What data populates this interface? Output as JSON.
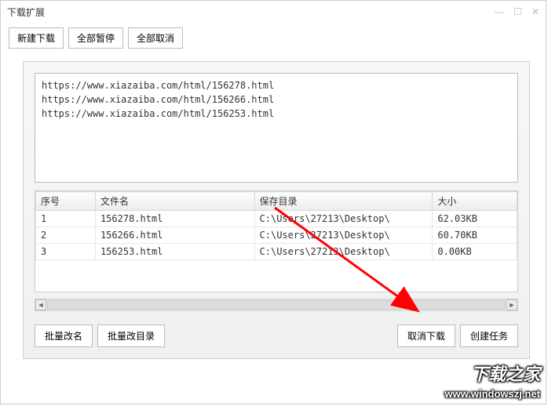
{
  "window": {
    "title": "下载扩展"
  },
  "toolbar": {
    "new_download": "新建下载",
    "pause_all": "全部暂停",
    "cancel_all": "全部取消"
  },
  "urls_text": "https://www.xiazaiba.com/html/156278.html\nhttps://www.xiazaiba.com/html/156266.html\nhttps://www.xiazaiba.com/html/156253.html",
  "table": {
    "headers": {
      "index": "序号",
      "filename": "文件名",
      "dir": "保存目录",
      "size": "大小"
    },
    "rows": [
      {
        "index": "1",
        "filename": "156278.html",
        "dir": "C:\\Users\\27213\\Desktop\\",
        "size": "62.03KB"
      },
      {
        "index": "2",
        "filename": "156266.html",
        "dir": "C:\\Users\\27213\\Desktop\\",
        "size": "60.70KB"
      },
      {
        "index": "3",
        "filename": "156253.html",
        "dir": "C:\\Users\\27213\\Desktop\\",
        "size": "0.00KB"
      }
    ]
  },
  "buttons": {
    "batch_rename": "批量改名",
    "batch_dir": "批量改目录",
    "cancel_download": "取消下载",
    "create_task": "创建任务"
  },
  "watermark": {
    "line1": "下载之家",
    "line2": "www.windowszj.net"
  }
}
